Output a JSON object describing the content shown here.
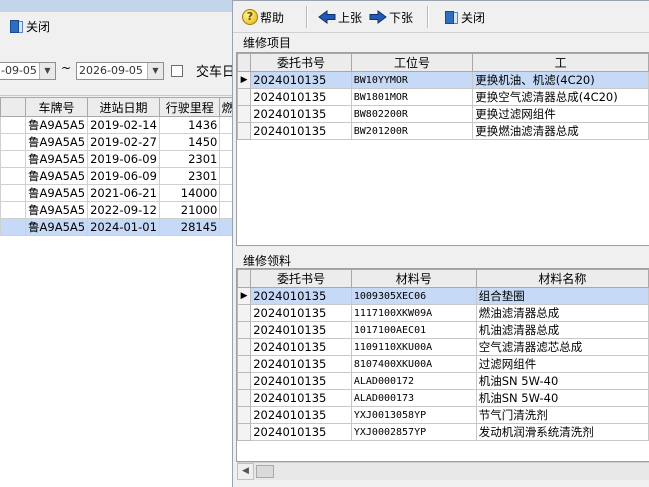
{
  "background_window": {
    "toolbar": {
      "close_label": "关闭"
    },
    "filter": {
      "date_from": "-09-05",
      "date_to": "2026-09-05",
      "date_range_sep": "~",
      "checkbox_label": "交车日"
    },
    "columns": [
      "车牌号",
      "进站日期",
      "行驶里程",
      "燃"
    ],
    "rows": [
      {
        "plate": "鲁A9A5A5",
        "date": "2019-02-14",
        "mileage": "1436"
      },
      {
        "plate": "鲁A9A5A5",
        "date": "2019-02-27",
        "mileage": "1450"
      },
      {
        "plate": "鲁A9A5A5",
        "date": "2019-06-09",
        "mileage": "2301"
      },
      {
        "plate": "鲁A9A5A5",
        "date": "2019-06-09",
        "mileage": "2301"
      },
      {
        "plate": "鲁A9A5A5",
        "date": "2021-06-21",
        "mileage": "14000"
      },
      {
        "plate": "鲁A9A5A5",
        "date": "2022-09-12",
        "mileage": "21000"
      },
      {
        "plate": "鲁A9A5A5",
        "date": "2024-01-01",
        "mileage": "28145"
      }
    ],
    "selected_row_index": 6
  },
  "dialog": {
    "toolbar": {
      "help_label": "帮助",
      "prev_label": "上张",
      "next_label": "下张",
      "close_label": "关闭"
    },
    "repair_items": {
      "title": "维修项目",
      "columns": [
        "委托书号",
        "工位号",
        "工"
      ],
      "rows": [
        {
          "order": "2024010135",
          "station": "BW10YYMOR",
          "item": "更换机油、机滤(4C20)"
        },
        {
          "order": "2024010135",
          "station": "BW1801MOR",
          "item": "更换空气滤清器总成(4C20)"
        },
        {
          "order": "2024010135",
          "station": "BW802200R",
          "item": "更换过滤网组件"
        },
        {
          "order": "2024010135",
          "station": "BW201200R",
          "item": "更换燃油滤清器总成"
        }
      ],
      "selected_row_index": 0
    },
    "materials": {
      "title": "维修领料",
      "columns": [
        "委托书号",
        "材料号",
        "材料名称"
      ],
      "rows": [
        {
          "order": "2024010135",
          "material_no": "1009305XEC06",
          "name": "组合垫圈"
        },
        {
          "order": "2024010135",
          "material_no": "1117100XKW09A",
          "name": "燃油滤清器总成"
        },
        {
          "order": "2024010135",
          "material_no": "1017100AEC01",
          "name": "机油滤清器总成"
        },
        {
          "order": "2024010135",
          "material_no": "1109110XKU00A",
          "name": "空气滤清器滤芯总成"
        },
        {
          "order": "2024010135",
          "material_no": "8107400XKU00A",
          "name": "过滤网组件"
        },
        {
          "order": "2024010135",
          "material_no": "ALAD000172",
          "name": "机油SN 5W-40"
        },
        {
          "order": "2024010135",
          "material_no": "ALAD000173",
          "name": "机油SN 5W-40"
        },
        {
          "order": "2024010135",
          "material_no": "YXJ0013058YP",
          "name": "节气门清洗剂"
        },
        {
          "order": "2024010135",
          "material_no": "YXJ0002857YP",
          "name": "发动机润滑系统清洗剂"
        }
      ],
      "selected_row_index": 0
    }
  },
  "colors": {
    "selection": "#c6daf7",
    "window_bg": "#f0f0f0",
    "icon_blue": "#2f6fc2",
    "help_icon": "#e4b400"
  },
  "icons": {
    "close": "door-exit-icon",
    "help": "question-icon",
    "prev": "arrow-left-icon",
    "next": "arrow-right-icon",
    "row_indicator": "row-pointer-icon"
  }
}
